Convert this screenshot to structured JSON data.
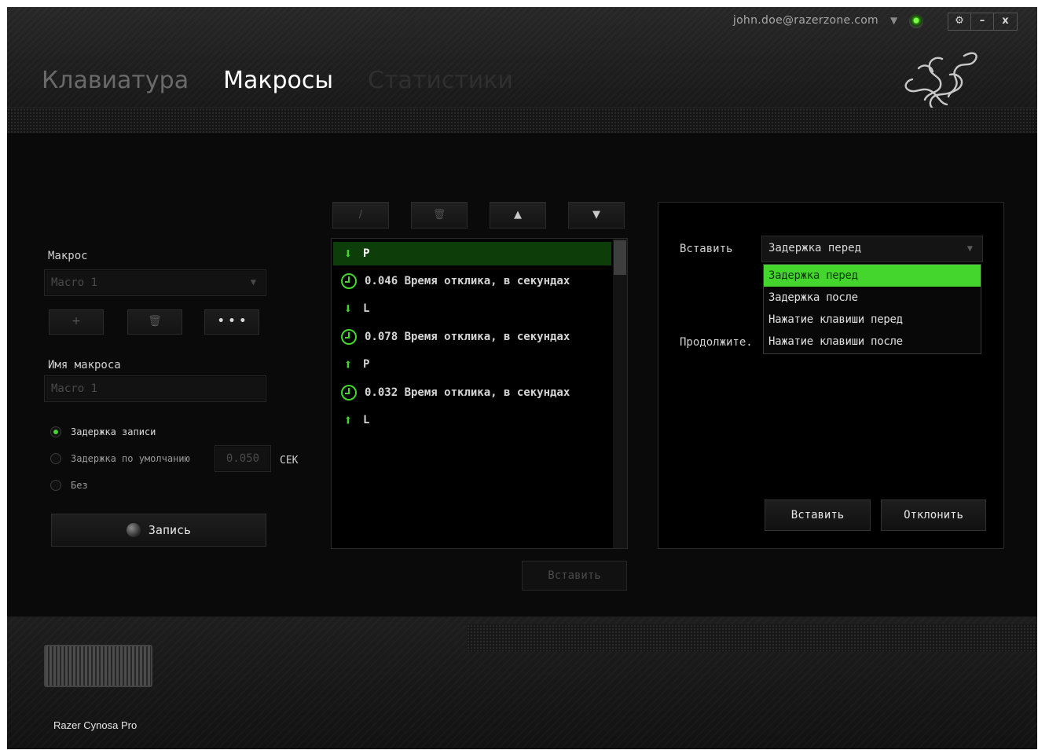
{
  "header": {
    "account_email": "john.doe@razerzone.com",
    "window_controls": {
      "settings": "⚙",
      "minimize": "–",
      "close": "x"
    },
    "tabs": [
      {
        "label": "Клавиатура",
        "state": "inactive"
      },
      {
        "label": "Макросы",
        "state": "active"
      },
      {
        "label": "Статистики",
        "state": "disabled"
      }
    ]
  },
  "left": {
    "macro_label": "Макрос",
    "macro_select_value": "Macro 1",
    "macro_buttons": {
      "add": "+",
      "delete": "🗑",
      "more": "• • •"
    },
    "macro_name_label": "Имя макроса",
    "macro_name_placeholder": "Macro 1",
    "delay_options": [
      {
        "label": "Задержка записи",
        "selected": true
      },
      {
        "label": "Задержка по умолчанию",
        "selected": false
      },
      {
        "label": "Без",
        "selected": false
      }
    ],
    "default_delay_value": "0.050",
    "delay_unit": "СЕК",
    "record_label": "Запись"
  },
  "middle": {
    "toolbar": {
      "edit": "/",
      "delete": "🗑",
      "up": "▲",
      "down": "▼"
    },
    "events": [
      {
        "icon": "arrow-down",
        "text": "P",
        "selected": true
      },
      {
        "icon": "clock",
        "text": "0.046 Время отклика, в секундах",
        "selected": false
      },
      {
        "icon": "arrow-down",
        "text": "L",
        "selected": false
      },
      {
        "icon": "clock",
        "text": "0.078 Время отклика, в секундах",
        "selected": false
      },
      {
        "icon": "arrow-up",
        "text": "P",
        "selected": false
      },
      {
        "icon": "clock",
        "text": "0.032 Время отклика, в секундах",
        "selected": false
      },
      {
        "icon": "arrow-up",
        "text": "L",
        "selected": false
      }
    ],
    "insert_label": "Вставить"
  },
  "right": {
    "insert_label": "Вставить",
    "insert_selected": "Задержка перед",
    "insert_options": [
      "Задержка перед",
      "Задержка после",
      "Нажатие клавиши перед",
      "Нажатие клавиши после"
    ],
    "continue_label": "Продолжите.",
    "apply_label": "Вставить",
    "cancel_label": "Отклонить"
  },
  "footer": {
    "device_name": "Razer Cynosa Pro"
  },
  "colors": {
    "accent": "#44d62c",
    "background": "#0a0a0a",
    "selected_row": "#0d3e0a"
  }
}
